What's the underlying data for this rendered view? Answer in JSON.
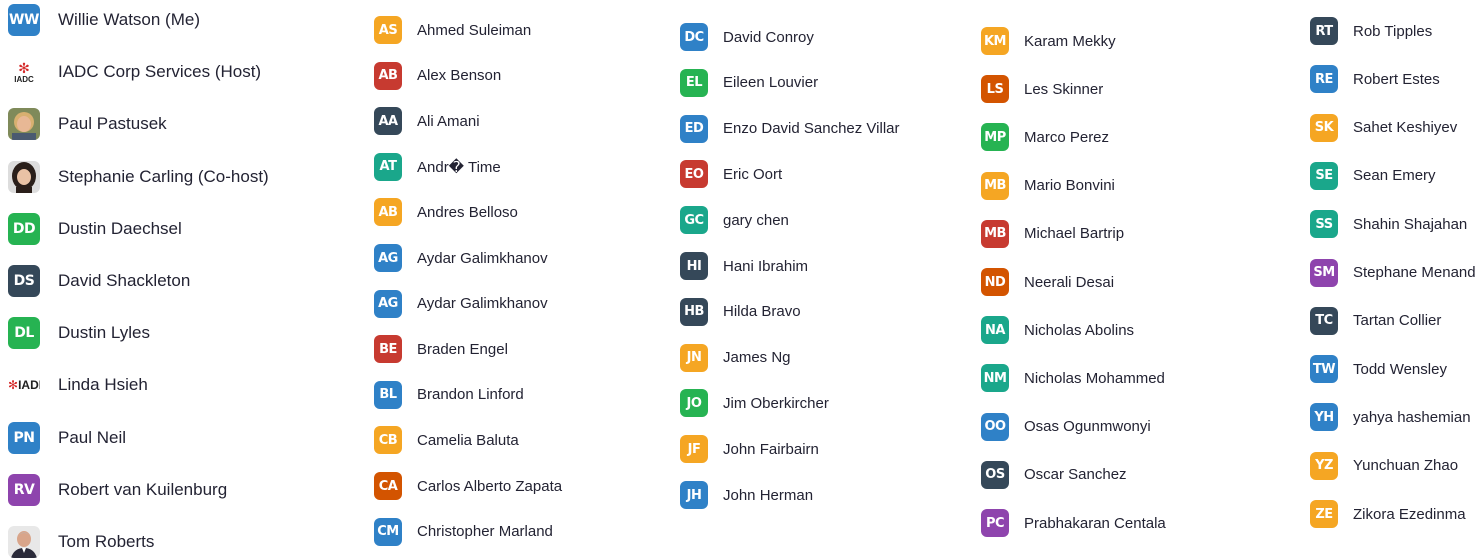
{
  "colors": {
    "orange": "#f5a623",
    "red": "#c73a30",
    "navy": "#354859",
    "teal": "#1aa78b",
    "blue": "#2f81c7",
    "green": "#26b352",
    "purple": "#8e44ad",
    "burnt": "#d35400"
  },
  "columns": [
    {
      "participants": [
        {
          "initials": "WW",
          "name": "Willie Watson (Me)",
          "color": "#2f81c7",
          "avatar": "initials"
        },
        {
          "initials": "",
          "name": "IADC Corp Services (Host)",
          "color": "",
          "avatar": "iadc-logo",
          "logo_text": "IADC"
        },
        {
          "initials": "",
          "name": "Paul Pastusek",
          "color": "",
          "avatar": "photo-1"
        },
        {
          "initials": "",
          "name": "Stephanie Carling (Co-host)",
          "color": "",
          "avatar": "photo-2"
        },
        {
          "initials": "DD",
          "name": "Dustin Daechsel",
          "color": "#26b352",
          "avatar": "initials"
        },
        {
          "initials": "DS",
          "name": "David Shackleton",
          "color": "#354859",
          "avatar": "initials"
        },
        {
          "initials": "DL",
          "name": "Dustin Lyles",
          "color": "#26b352",
          "avatar": "initials"
        },
        {
          "initials": "",
          "name": "Linda Hsieh",
          "color": "",
          "avatar": "iadc-clipped",
          "logo_text": "IADI"
        },
        {
          "initials": "PN",
          "name": "Paul Neil",
          "color": "#2f81c7",
          "avatar": "initials"
        },
        {
          "initials": "RV",
          "name": "Robert van Kuilenburg",
          "color": "#8e44ad",
          "avatar": "initials"
        },
        {
          "initials": "",
          "name": "Tom Roberts",
          "color": "",
          "avatar": "photo-3"
        }
      ]
    },
    {
      "participants": [
        {
          "initials": "AS",
          "name": "Ahmed Suleiman",
          "color": "#f5a623",
          "avatar": "initials"
        },
        {
          "initials": "AB",
          "name": "Alex Benson",
          "color": "#c73a30",
          "avatar": "initials"
        },
        {
          "initials": "AA",
          "name": "Ali Amani",
          "color": "#354859",
          "avatar": "initials"
        },
        {
          "initials": "AT",
          "name": "Andr� Time",
          "color": "#1aa78b",
          "avatar": "initials"
        },
        {
          "initials": "AB",
          "name": "Andres Belloso",
          "color": "#f5a623",
          "avatar": "initials"
        },
        {
          "initials": "AG",
          "name": "Aydar Galimkhanov",
          "color": "#2f81c7",
          "avatar": "initials"
        },
        {
          "initials": "AG",
          "name": "Aydar Galimkhanov",
          "color": "#2f81c7",
          "avatar": "initials"
        },
        {
          "initials": "BE",
          "name": "Braden Engel",
          "color": "#c73a30",
          "avatar": "initials"
        },
        {
          "initials": "BL",
          "name": "Brandon Linford",
          "color": "#2f81c7",
          "avatar": "initials"
        },
        {
          "initials": "CB",
          "name": "Camelia Baluta",
          "color": "#f5a623",
          "avatar": "initials"
        },
        {
          "initials": "CA",
          "name": "Carlos Alberto Zapata",
          "color": "#d35400",
          "avatar": "initials"
        },
        {
          "initials": "CM",
          "name": "Christopher Marland",
          "color": "#2f81c7",
          "avatar": "initials"
        }
      ]
    },
    {
      "participants": [
        {
          "initials": "DC",
          "name": "David Conroy",
          "color": "#2f81c7",
          "avatar": "initials"
        },
        {
          "initials": "EL",
          "name": "Eileen Louvier",
          "color": "#26b352",
          "avatar": "initials"
        },
        {
          "initials": "ED",
          "name": "Enzo David Sanchez Villar",
          "color": "#2f81c7",
          "avatar": "initials"
        },
        {
          "initials": "EO",
          "name": "Eric Oort",
          "color": "#c73a30",
          "avatar": "initials"
        },
        {
          "initials": "GC",
          "name": "gary chen",
          "color": "#1aa78b",
          "avatar": "initials"
        },
        {
          "initials": "HI",
          "name": "Hani Ibrahim",
          "color": "#354859",
          "avatar": "initials"
        },
        {
          "initials": "HB",
          "name": "Hilda Bravo",
          "color": "#354859",
          "avatar": "initials"
        },
        {
          "initials": "JN",
          "name": "James Ng",
          "color": "#f5a623",
          "avatar": "initials"
        },
        {
          "initials": "JO",
          "name": "Jim Oberkircher",
          "color": "#26b352",
          "avatar": "initials"
        },
        {
          "initials": "JF",
          "name": "John Fairbairn",
          "color": "#f5a623",
          "avatar": "initials"
        },
        {
          "initials": "JH",
          "name": "John Herman",
          "color": "#2f81c7",
          "avatar": "initials"
        }
      ]
    },
    {
      "participants": [
        {
          "initials": "KM",
          "name": "Karam Mekky",
          "color": "#f5a623",
          "avatar": "initials"
        },
        {
          "initials": "LS",
          "name": "Les Skinner",
          "color": "#d35400",
          "avatar": "initials"
        },
        {
          "initials": "MP",
          "name": "Marco Perez",
          "color": "#26b352",
          "avatar": "initials"
        },
        {
          "initials": "MB",
          "name": "Mario Bonvini",
          "color": "#f5a623",
          "avatar": "initials"
        },
        {
          "initials": "MB",
          "name": "Michael Bartrip",
          "color": "#c73a30",
          "avatar": "initials"
        },
        {
          "initials": "ND",
          "name": "Neerali Desai",
          "color": "#d35400",
          "avatar": "initials"
        },
        {
          "initials": "NA",
          "name": "Nicholas Abolins",
          "color": "#1aa78b",
          "avatar": "initials"
        },
        {
          "initials": "NM",
          "name": "Nicholas Mohammed",
          "color": "#1aa78b",
          "avatar": "initials"
        },
        {
          "initials": "OO",
          "name": "Osas Ogunmwonyi",
          "color": "#2f81c7",
          "avatar": "initials"
        },
        {
          "initials": "OS",
          "name": "Oscar Sanchez",
          "color": "#354859",
          "avatar": "initials"
        },
        {
          "initials": "PC",
          "name": "Prabhakaran Centala",
          "color": "#8e44ad",
          "avatar": "initials"
        }
      ]
    },
    {
      "participants": [
        {
          "initials": "RT",
          "name": "Rob Tipples",
          "color": "#354859",
          "avatar": "initials"
        },
        {
          "initials": "RE",
          "name": "Robert Estes",
          "color": "#2f81c7",
          "avatar": "initials"
        },
        {
          "initials": "SK",
          "name": "Sahet Keshiyev",
          "color": "#f5a623",
          "avatar": "initials"
        },
        {
          "initials": "SE",
          "name": "Sean Emery",
          "color": "#1aa78b",
          "avatar": "initials"
        },
        {
          "initials": "SS",
          "name": "Shahin Shajahan",
          "color": "#1aa78b",
          "avatar": "initials"
        },
        {
          "initials": "SM",
          "name": "Stephane Menand",
          "color": "#8e44ad",
          "avatar": "initials"
        },
        {
          "initials": "TC",
          "name": "Tartan Collier",
          "color": "#354859",
          "avatar": "initials"
        },
        {
          "initials": "TW",
          "name": "Todd Wensley",
          "color": "#2f81c7",
          "avatar": "initials"
        },
        {
          "initials": "YH",
          "name": "yahya hashemian",
          "color": "#2f81c7",
          "avatar": "initials"
        },
        {
          "initials": "YZ",
          "name": "Yunchuan Zhao",
          "color": "#f5a623",
          "avatar": "initials"
        },
        {
          "initials": "ZE",
          "name": "Zikora Ezedinma",
          "color": "#f5a623",
          "avatar": "initials"
        }
      ]
    }
  ]
}
